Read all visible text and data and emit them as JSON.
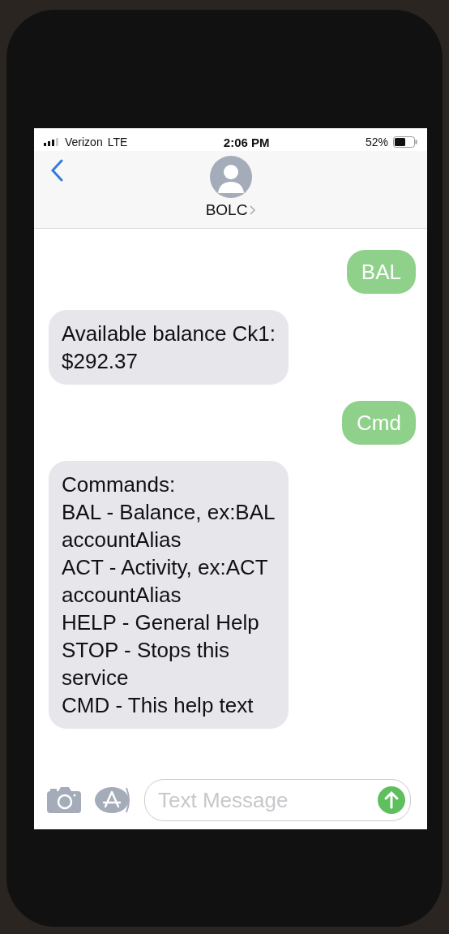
{
  "status_bar": {
    "carrier": "Verizon",
    "network": "LTE",
    "time": "2:06 PM",
    "battery": "52%"
  },
  "header": {
    "contact": "BOLC"
  },
  "messages": [
    {
      "kind": "sent",
      "text": "BAL"
    },
    {
      "kind": "received",
      "text": "Available balance Ck1:\n$292.37"
    },
    {
      "kind": "sent",
      "text": "Cmd"
    },
    {
      "kind": "received",
      "text": "Commands:\nBAL - Balance, ex:BAL\naccountAlias\nACT - Activity, ex:ACT\naccountAlias\nHELP - General Help\nSTOP - Stops this\nservice\nCMD - This help text"
    }
  ],
  "composer": {
    "placeholder": "Text Message"
  }
}
